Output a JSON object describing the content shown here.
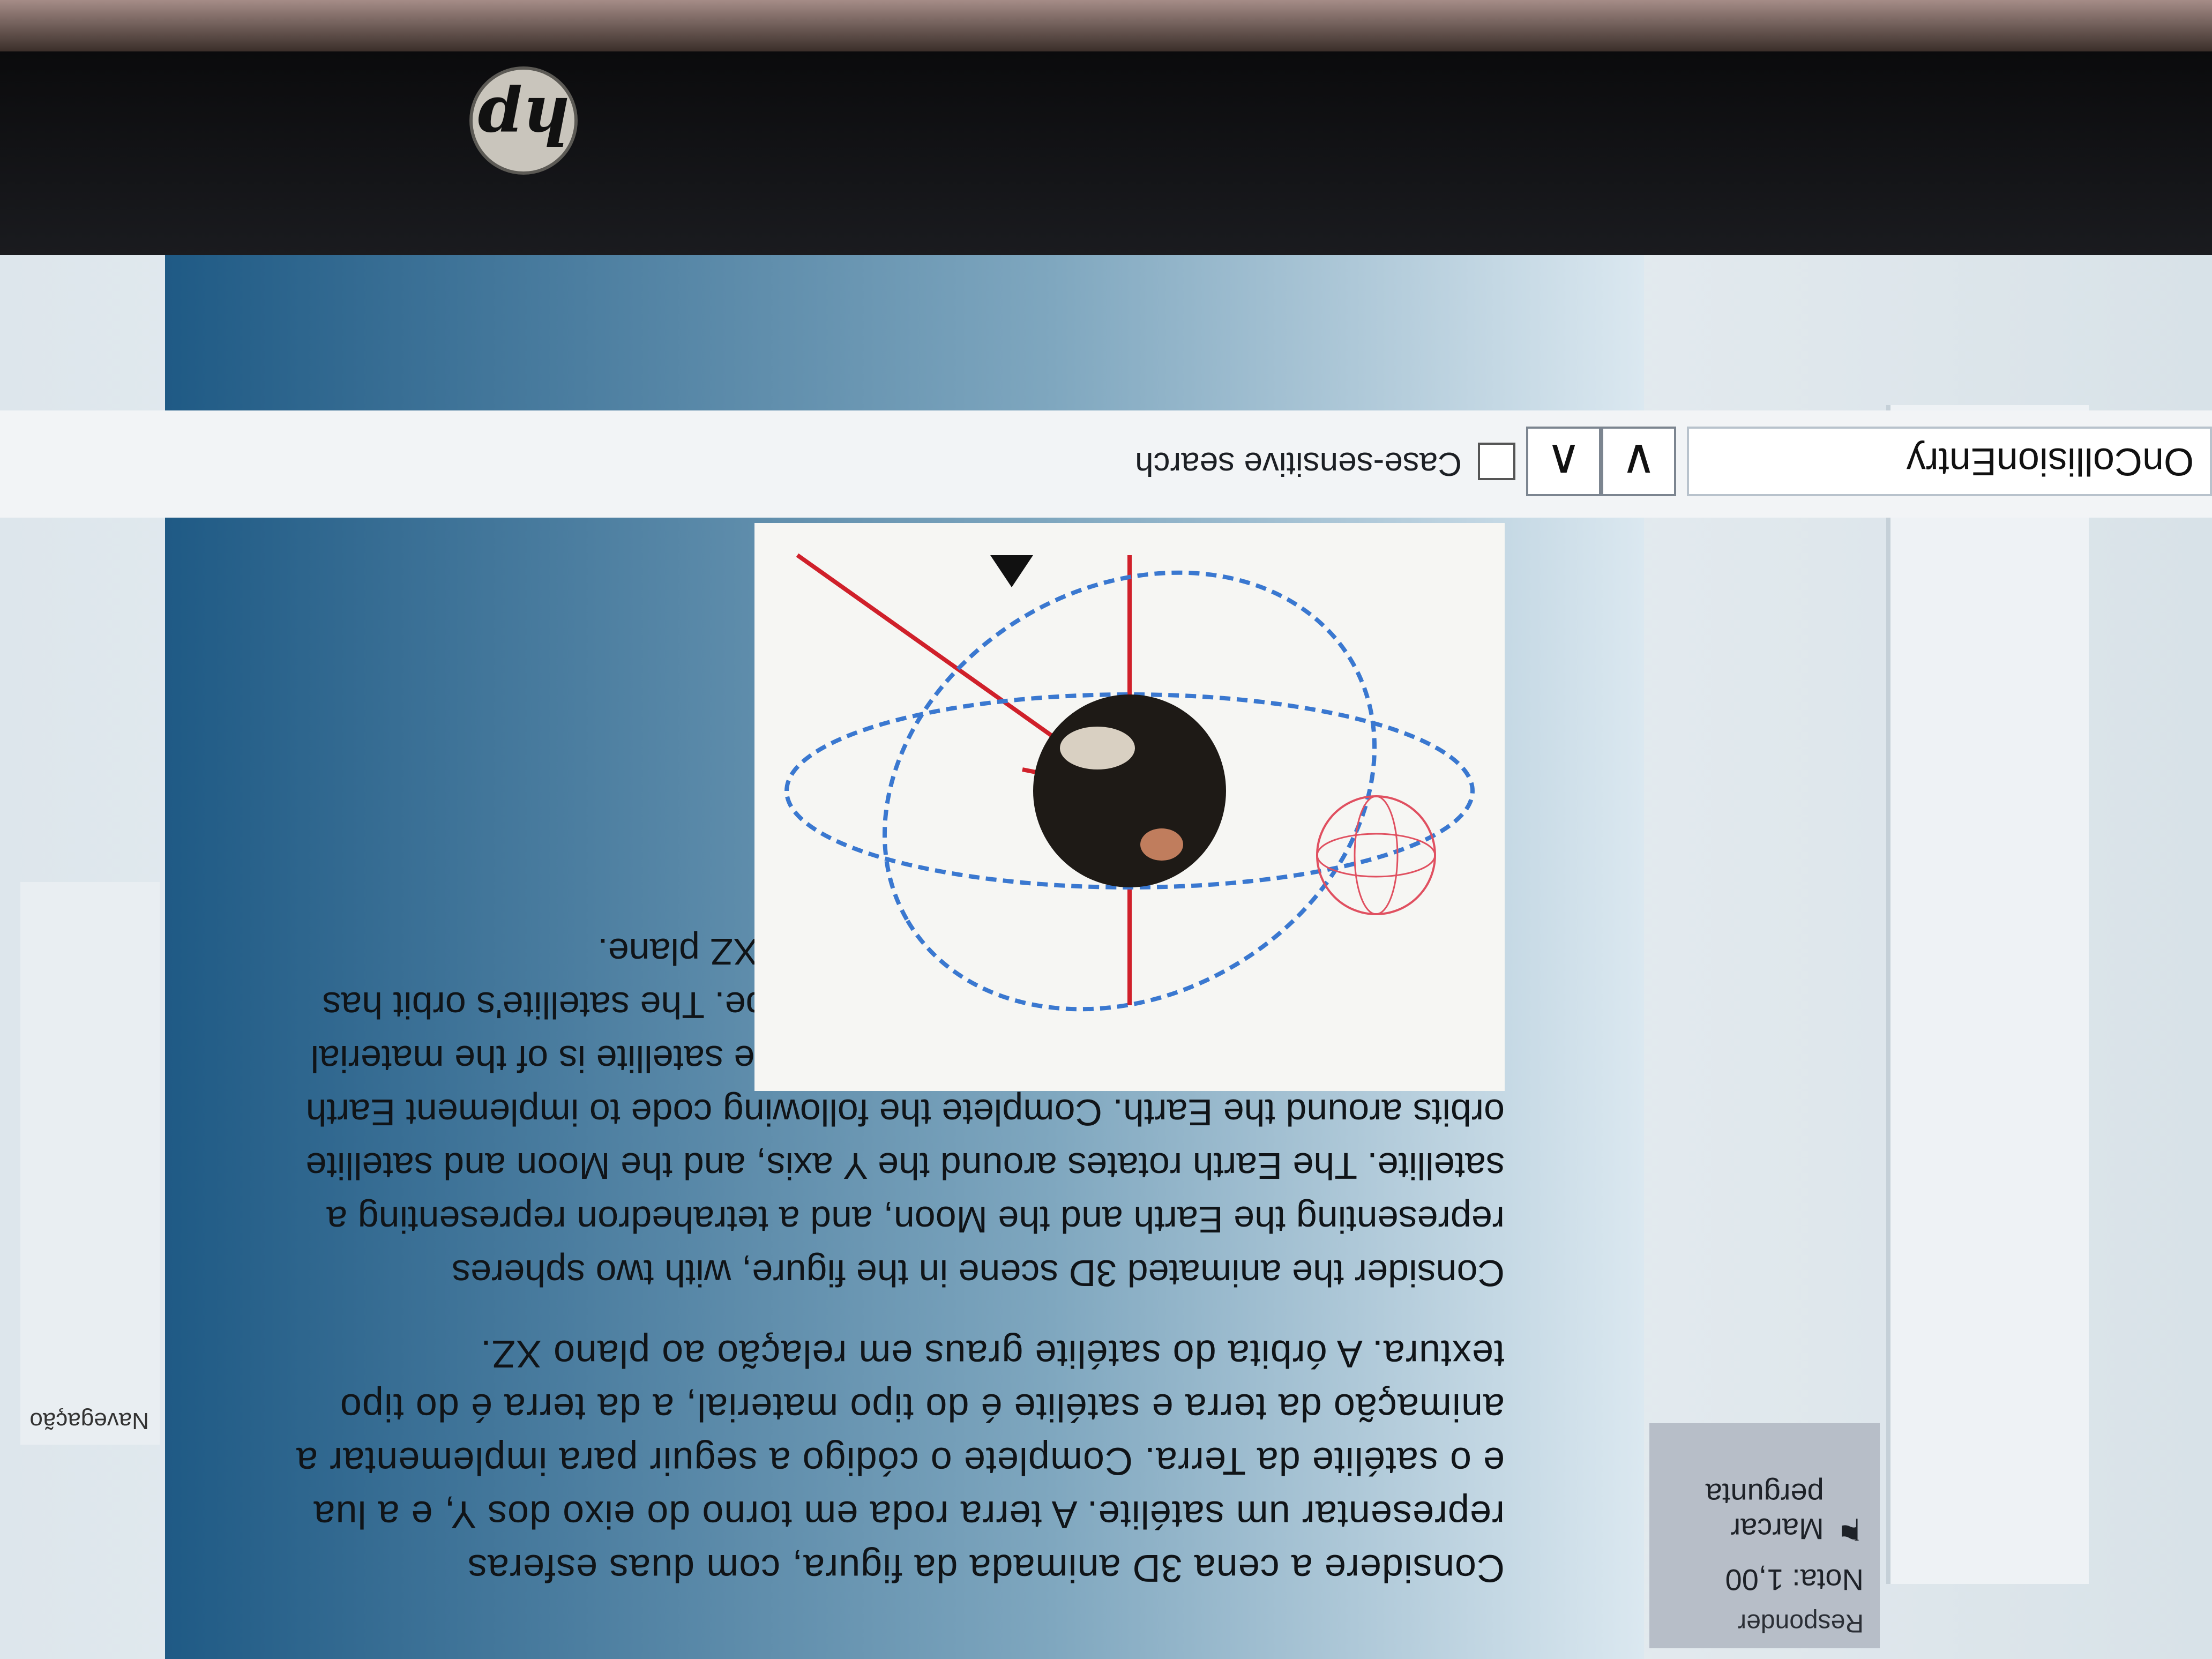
{
  "hp": {
    "logo": "hp"
  },
  "sidebar": {
    "respond_label": "Responder",
    "grade": "Nota: 1,00",
    "flag_label": "Marcar pergunta",
    "flag_icon": "flag-icon"
  },
  "question": {
    "text_pt": "Considere a cena 3D animada da figura, com duas esferas representar um satélite. A terra roda em torno do eixo dos Y, e a lua e o satélite da Terra. Complete o código a seguir para implementar a animação da terra e satélite é do tipo material, a da terra é do tipo textura. A órbita do satélite graus em relação ao plano XZ.",
    "text_en": "Consider the animated 3D scene in the figure, with two spheres representing the Earth and the Moon, and a tetrahedron representing a satellite. The Earth rotates around the Y axis, and the Moon and satellite orbits around the Earth. Complete the following code to implement Earth and satellite animation. The appearance of the satellite is of the material type, and that of the Earth is of the texture type. The satellite's orbit has an inclination of 45 degrees in relation to the XZ plane."
  },
  "search": {
    "value": "OnCollisionEntry",
    "next_icon": "chevron-down-icon",
    "prev_icon": "chevron-up-icon",
    "case_label": "Case-sensitive search"
  },
  "side_nav": {
    "title": "Navegação"
  }
}
